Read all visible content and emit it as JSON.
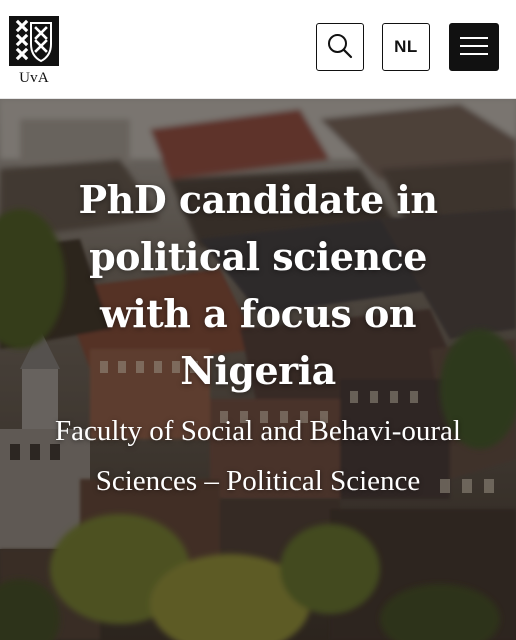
{
  "header": {
    "logo_text": "UvA",
    "language_label": "NL",
    "search_icon": "search-icon",
    "menu_icon": "hamburger-menu-icon",
    "logo_icon": "uva-crest-icon"
  },
  "hero": {
    "title": "PhD candidate in political science with a focus on Nigeria",
    "subtitle": "Faculty of Social and Behavi-oural Sciences – Political Science",
    "background_image": "aerial-city-rooftops-photo"
  },
  "colors": {
    "header_bg": "#ffffff",
    "logo_bg": "#111111",
    "menu_button_bg": "#111111",
    "hero_text": "#ffffff"
  }
}
